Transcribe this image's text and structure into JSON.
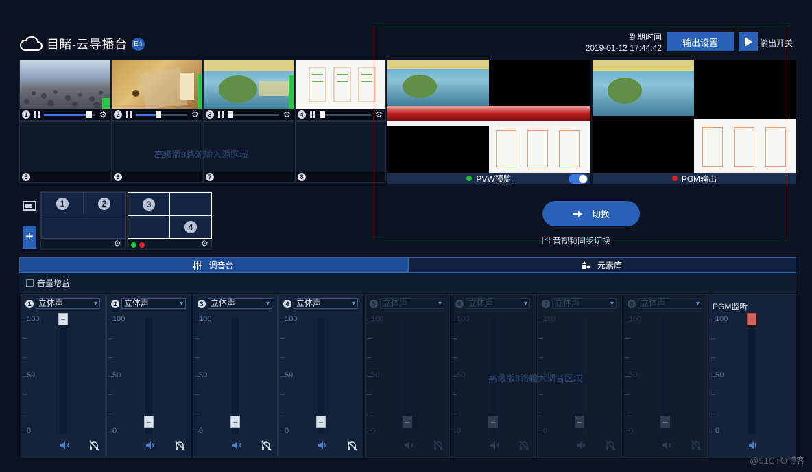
{
  "header": {
    "title": "目睹·云导播台",
    "lang_badge": "En",
    "expiry_label": "到期时间",
    "expiry_time": "2019-01-12 17:44:42",
    "output_settings": "输出设置",
    "output_switch": "输出开关"
  },
  "sources": {
    "items": [
      {
        "num": "1",
        "volume_pct": 88
      },
      {
        "num": "2",
        "volume_pct": 42
      },
      {
        "num": "3",
        "volume_pct": 5
      },
      {
        "num": "4",
        "volume_pct": 5
      }
    ],
    "empty_slots": [
      "5",
      "6",
      "7",
      "8"
    ],
    "advanced_placeholder": "高级版8路流输入源区域"
  },
  "preview": {
    "pvw_label": "PVW预监",
    "pgm_label": "PGM输出",
    "pvw_color": "#22c33a",
    "pgm_color": "#e02020"
  },
  "layouts": {
    "a": [
      "1",
      "2"
    ],
    "b": [
      "3",
      "4"
    ]
  },
  "switch": {
    "label": "切换",
    "sync_label": "音视频同步切换"
  },
  "tabs": {
    "mixer": "调音台",
    "elements": "元素库"
  },
  "mixer": {
    "gain_label": "音量增益",
    "channels": [
      {
        "num": "1",
        "mode": "立体声",
        "level_pct": 100
      },
      {
        "num": "2",
        "mode": "立体声",
        "level_pct": 0
      },
      {
        "num": "3",
        "mode": "立体声",
        "level_pct": 0
      },
      {
        "num": "4",
        "mode": "立体声",
        "level_pct": 0
      },
      {
        "num": "5",
        "mode": "立体声",
        "level_pct": 0
      },
      {
        "num": "6",
        "mode": "立体声",
        "level_pct": 0
      },
      {
        "num": "7",
        "mode": "立体声",
        "level_pct": 0
      },
      {
        "num": "8",
        "mode": "立体声",
        "level_pct": 0
      }
    ],
    "scale": {
      "top": "100",
      "mid": "50",
      "bottom": "0"
    },
    "advanced_placeholder": "高级版8路输入调音区域",
    "pgm_monitor_label": "PGM监听",
    "pgm_level_pct": 100
  },
  "watermark": "@51CTO博客"
}
